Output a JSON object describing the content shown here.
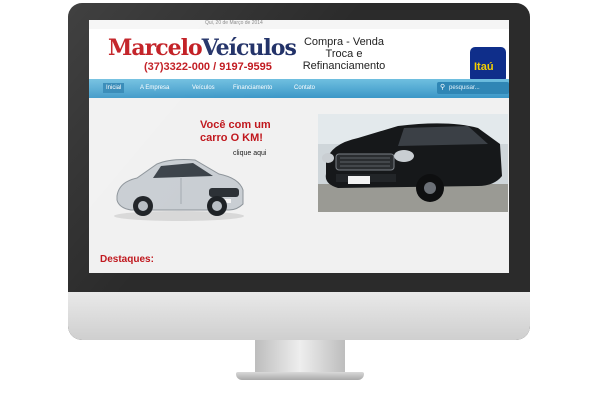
{
  "site": {
    "date": "Qui, 20 de Março de 2014",
    "logo_part1": "Marcelo",
    "logo_part2": "Veículos",
    "phone": "(37)3322-000 / 9197-9595",
    "tagline_line1": "Compra - Venda",
    "tagline_line2": "Troca e",
    "tagline_line3": "Refinanciamento",
    "bank_badge": "Itaú"
  },
  "nav": {
    "items": [
      "Inicial",
      "A Empresa",
      "Veículos",
      "Financiamento",
      "Contato"
    ],
    "search_placeholder": "pesquisar..."
  },
  "promo": {
    "title_line1": "Você com um",
    "title_line2": "carro O KM!",
    "link": "clique aqui"
  },
  "section": {
    "title": "Destaques:"
  },
  "colors": {
    "brand_red": "#c0161c",
    "brand_navy": "#1f2f66",
    "nav_blue": "#3b97c7",
    "bank_blue": "#0f2e8a",
    "bank_yellow": "#f5d000"
  }
}
